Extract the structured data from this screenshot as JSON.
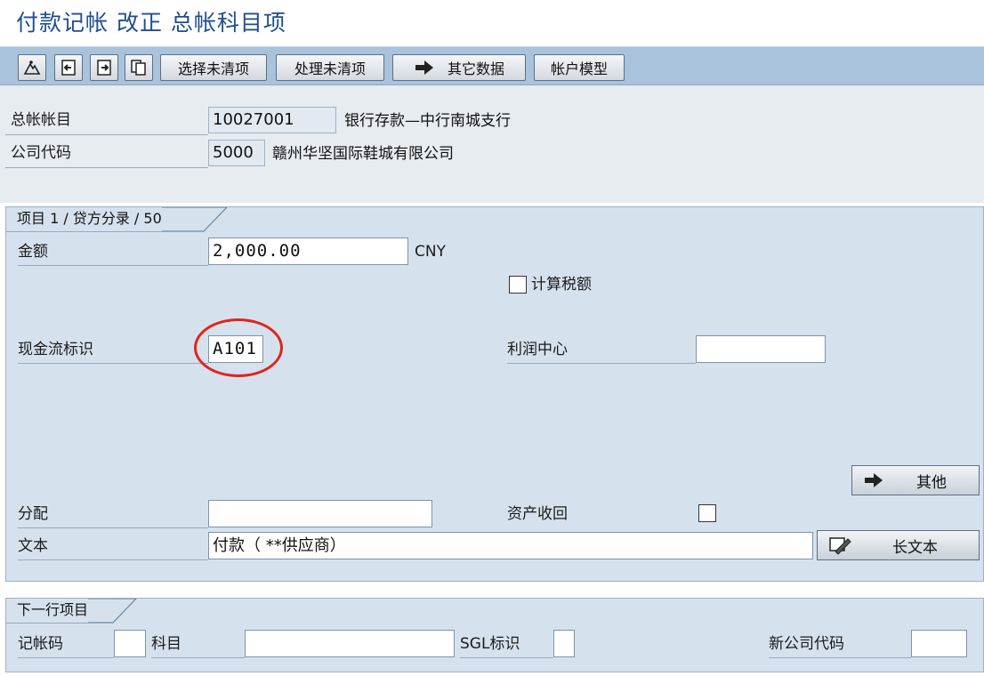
{
  "window": {
    "title": "付款记帐 改正 总帐科目项"
  },
  "toolbar": {
    "icons": [
      "mountain-icon",
      "previous-item-icon",
      "next-item-icon",
      "copy-icon"
    ],
    "select_open_items": "选择未清项",
    "process_open_items": "处理未清项",
    "other_data": "其它数据",
    "account_model": "帐户模型"
  },
  "header": {
    "gl_account_label": "总帐帐目",
    "gl_account_value": "10027001",
    "gl_account_desc": "银行存款—中行南城支行",
    "company_code_label": "公司代码",
    "company_code_value": "5000",
    "company_code_desc": "赣州华坚国际鞋城有限公司"
  },
  "item": {
    "group_title": "项目 1 / 贷方分录 / 50",
    "amount_label": "金额",
    "amount_value": "2,000.00",
    "currency": "CNY",
    "calc_tax_label": "计算税额",
    "calc_tax_checked": false,
    "cash_flow_label": "现金流标识",
    "cash_flow_value": "A101",
    "profit_center_label": "利润中心",
    "profit_center_value": "",
    "more_button": "其他",
    "assignment_label": "分配",
    "assignment_value": "",
    "asset_retirement_label": "资产收回",
    "asset_retirement_checked": false,
    "text_label": "文本",
    "text_value": "付款（ **供应商）",
    "long_text_button": "长文本"
  },
  "next_item": {
    "group_title": "下一行项目",
    "posting_key_label": "记帐码",
    "posting_key_value": "",
    "account_label": "科目",
    "account_value": "",
    "sgl_label": "SGL标识",
    "sgl_value": "",
    "new_company_code_label": "新公司代码",
    "new_company_code_value": ""
  },
  "highlight": {
    "color": "#e0251b",
    "target": "cash_flow_value"
  }
}
